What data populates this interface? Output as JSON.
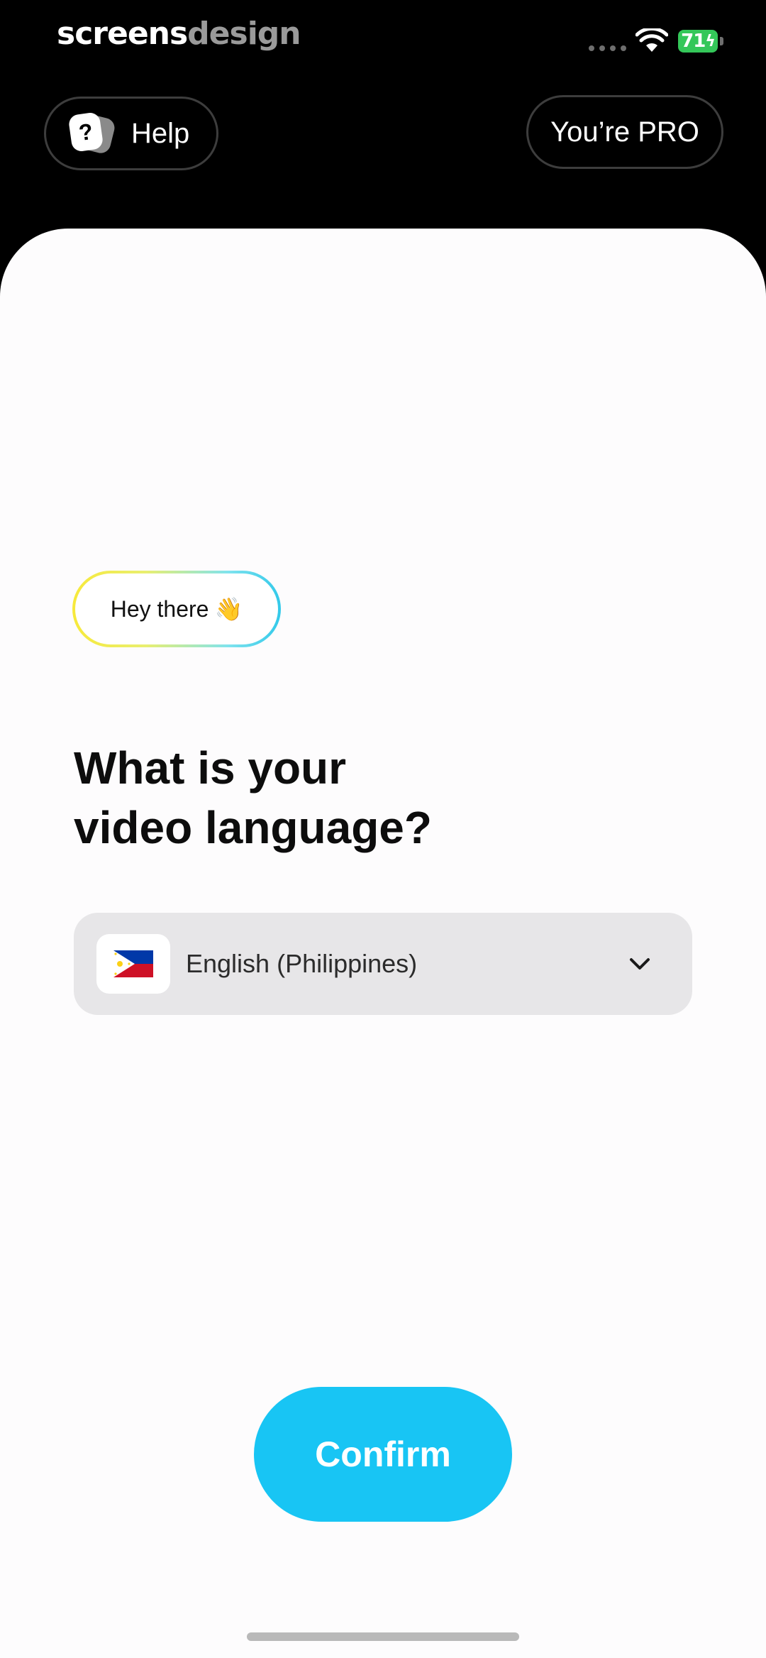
{
  "status_bar": {
    "watermark_part1": "screens",
    "watermark_part2": "design",
    "battery_level": "71"
  },
  "header": {
    "help_label": "Help",
    "help_icon_glyph": "?",
    "pro_label": "You’re PRO"
  },
  "main": {
    "greeting": "Hey there",
    "greeting_emoji": "👋",
    "title_line1": "What is your",
    "title_line2": "video language?",
    "language": {
      "flag": "🇵🇭",
      "selected": "English (Philippines)"
    },
    "confirm_label": "Confirm"
  },
  "icons": [
    "help-icon",
    "wifi-icon",
    "battery-icon",
    "waving-hand-icon",
    "philippines-flag-icon",
    "chevron-down-icon"
  ],
  "colors": {
    "accent": "#18c5f4",
    "battery": "#34c759",
    "select_bg": "#e7e6e8",
    "greeting_gradient_start": "#f7e93a",
    "greeting_gradient_end": "#32c9ea"
  }
}
